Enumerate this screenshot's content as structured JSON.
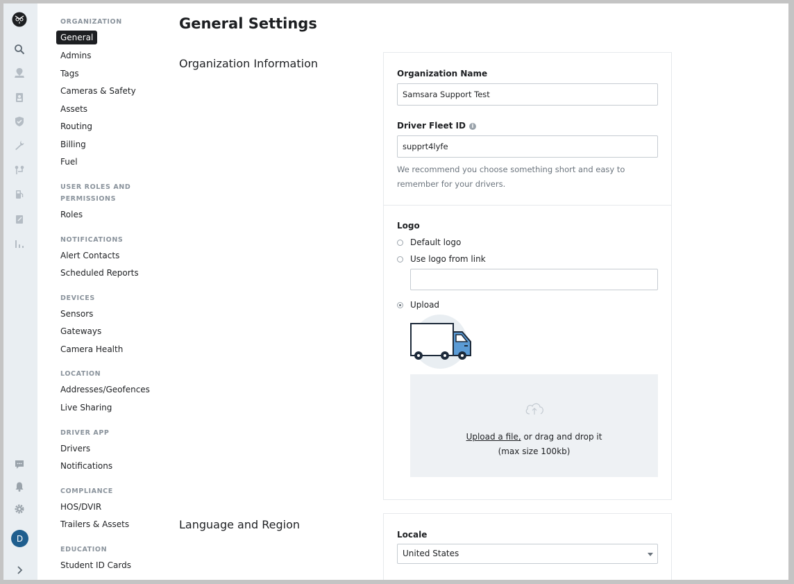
{
  "rail": {
    "avatar_initial": "D",
    "icons": [
      "samsara-owl-logo",
      "search-icon",
      "map-pin-icon",
      "clipboard-user-icon",
      "shield-check-icon",
      "wrench-icon",
      "route-icon",
      "fuel-pump-icon",
      "document-edit-icon",
      "bar-chart-icon",
      "chat-icon",
      "bell-icon",
      "gear-icon",
      "chevron-right-icon"
    ]
  },
  "nav": {
    "groups": [
      {
        "heading": "ORGANIZATION",
        "items": [
          "General",
          "Admins",
          "Tags",
          "Cameras & Safety",
          "Assets",
          "Routing",
          "Billing",
          "Fuel"
        ]
      },
      {
        "heading": "USER ROLES AND PERMISSIONS",
        "items": [
          "Roles"
        ]
      },
      {
        "heading": "NOTIFICATIONS",
        "items": [
          "Alert Contacts",
          "Scheduled Reports"
        ]
      },
      {
        "heading": "DEVICES",
        "items": [
          "Sensors",
          "Gateways",
          "Camera Health"
        ]
      },
      {
        "heading": "LOCATION",
        "items": [
          "Addresses/Geofences",
          "Live Sharing"
        ]
      },
      {
        "heading": "DRIVER APP",
        "items": [
          "Drivers",
          "Notifications"
        ]
      },
      {
        "heading": "COMPLIANCE",
        "items": [
          "HOS/DVIR",
          "Trailers & Assets"
        ]
      },
      {
        "heading": "EDUCATION",
        "items": [
          "Student ID Cards"
        ]
      }
    ],
    "active_item": "General"
  },
  "page": {
    "title": "General Settings",
    "org_section_title": "Organization Information",
    "lang_section_title": "Language and Region"
  },
  "org": {
    "name_label": "Organization Name",
    "name_value": "Samsara Support Test",
    "fleet_id_label": "Driver Fleet ID",
    "fleet_id_value": "supprt4lyfe",
    "fleet_id_help": "We recommend you choose something short and easy to remember for your drivers."
  },
  "logo": {
    "label": "Logo",
    "options": [
      "Default logo",
      "Use logo from link",
      "Upload"
    ],
    "selected": "Upload",
    "link_value": "",
    "upload_link": "Upload a file,",
    "upload_text": " or drag and drop it",
    "upload_limit": "(max size 100kb)"
  },
  "locale": {
    "label": "Locale",
    "value": "United States"
  },
  "colors": {
    "rail_bg": "#e9eef2",
    "active_nav": "#1d1f22",
    "avatar": "#1f5e8e",
    "truck_blue": "#5b9bd5"
  }
}
